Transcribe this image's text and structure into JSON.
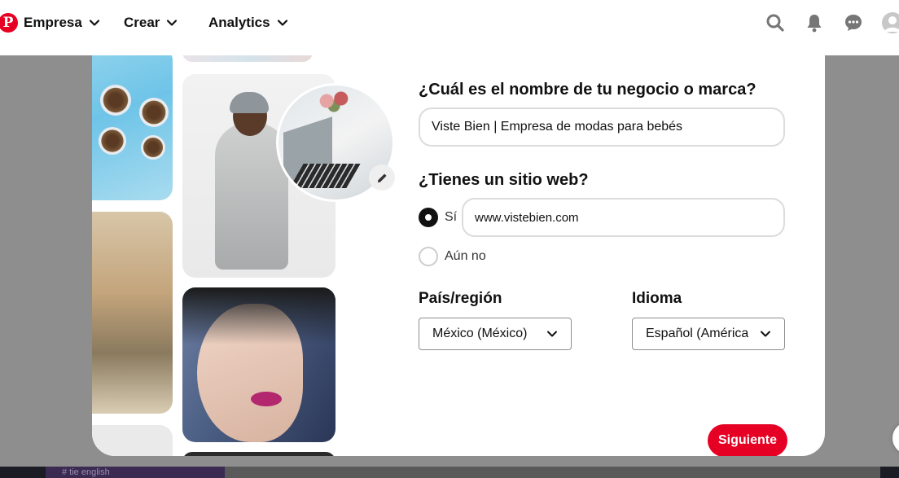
{
  "nav": {
    "logo_letter": "P",
    "items": [
      {
        "label": "Empresa"
      },
      {
        "label": "Crear"
      },
      {
        "label": "Analytics"
      }
    ]
  },
  "icons": {
    "search": "search-icon",
    "notifications": "bell-icon",
    "messages": "chat-icon",
    "profile": "avatar-icon"
  },
  "form": {
    "business_question": "¿Cuál es el nombre de tu negocio o marca?",
    "business_name_value": "Viste Bien | Empresa de modas para bebés",
    "website_question": "¿Tienes un sitio web?",
    "radio_yes_label": "Sí",
    "radio_no_label": "Aún no",
    "radio_selected": "yes",
    "website_value": "www.vistebien.com",
    "country_label": "País/región",
    "country_value": "México (México)",
    "language_label": "Idioma",
    "language_value": "Español (América",
    "next_button": "Siguiente"
  },
  "background": {
    "strip_text": "# tie english"
  },
  "colors": {
    "brand": "#e60023",
    "overlay": "#8e8e8e"
  }
}
